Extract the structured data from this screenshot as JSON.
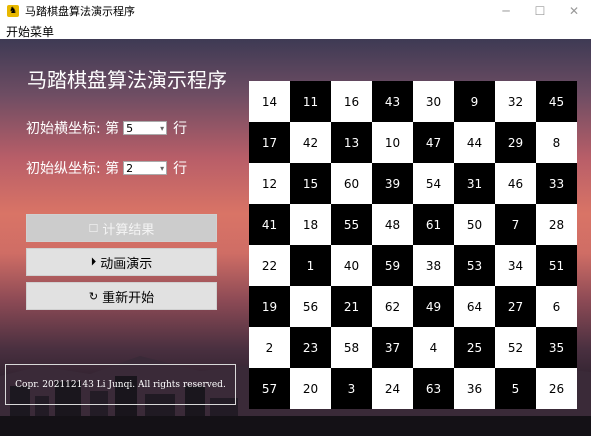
{
  "window": {
    "title": "马踏棋盘算法演示程序",
    "menu": "开始菜单"
  },
  "heading": "马踏棋盘算法演示程序",
  "coords": {
    "x_label": "初始横坐标: 第",
    "x_value": "5",
    "x_suffix": "行",
    "y_label": "初始纵坐标: 第",
    "y_value": "2",
    "y_suffix": "行"
  },
  "buttons": {
    "compute": "计算结果",
    "animate": "动画演示",
    "restart": "重新开始"
  },
  "copyright": "Copr. 202112143 Li Junqi. All rights reserved.",
  "board": [
    [
      14,
      11,
      16,
      43,
      30,
      9,
      32,
      45
    ],
    [
      17,
      42,
      13,
      10,
      47,
      44,
      29,
      8
    ],
    [
      12,
      15,
      60,
      39,
      54,
      31,
      46,
      33
    ],
    [
      41,
      18,
      55,
      48,
      61,
      50,
      7,
      28
    ],
    [
      22,
      1,
      40,
      59,
      38,
      53,
      34,
      51
    ],
    [
      19,
      56,
      21,
      62,
      49,
      64,
      27,
      6
    ],
    [
      2,
      23,
      58,
      37,
      4,
      25,
      52,
      35
    ],
    [
      57,
      20,
      3,
      24,
      63,
      36,
      5,
      26
    ]
  ]
}
